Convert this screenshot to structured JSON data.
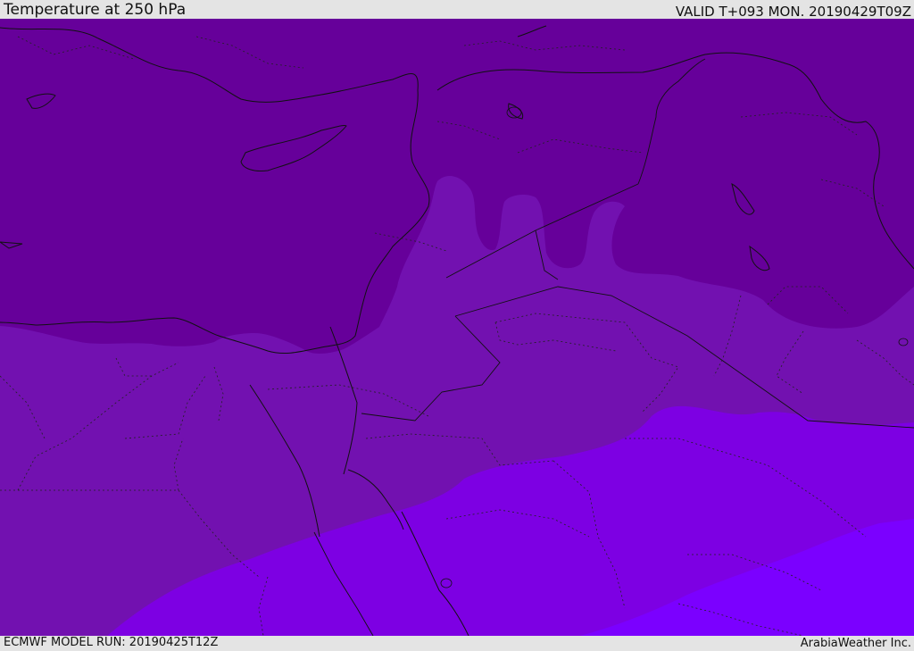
{
  "header": {
    "title": "Temperature at 250 hPa",
    "valid_time": "VALID T+093 MON. 20190429T09Z"
  },
  "footer": {
    "model_run": "ECMWF MODEL RUN: 20190425T12Z",
    "credit": "ArabiaWeather Inc."
  },
  "map": {
    "product": "temperature",
    "level": "250 hPa",
    "temperature_bands": [
      {
        "name": "coldest-band",
        "color": "#7b00ff"
      },
      {
        "name": "cold-band",
        "color": "#7d00e3"
      },
      {
        "name": "mid-band",
        "color": "#7211b0"
      },
      {
        "name": "warm-band",
        "color": "#66009a"
      }
    ]
  }
}
